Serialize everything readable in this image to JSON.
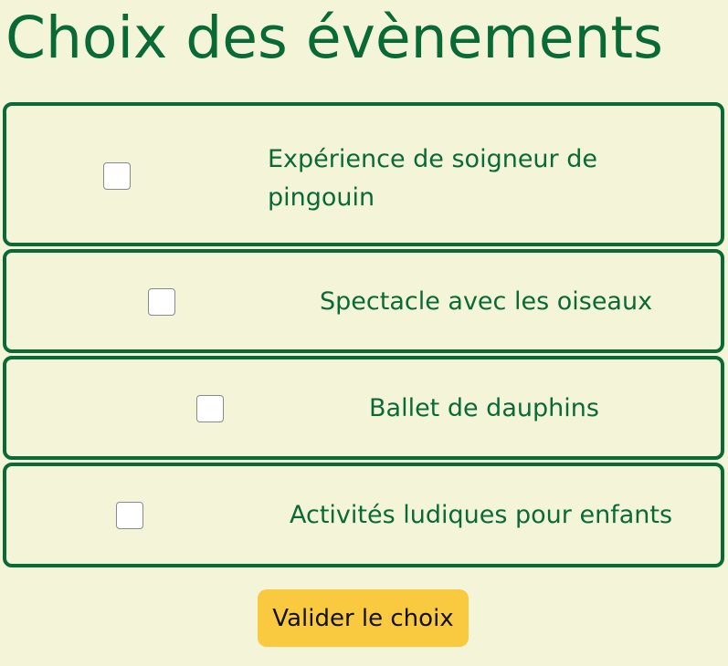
{
  "page": {
    "title": "Choix des évènements"
  },
  "events": [
    {
      "label": "Expérience de soigneur de pingouin",
      "checked": false
    },
    {
      "label": "Spectacle avec les oiseaux",
      "checked": false
    },
    {
      "label": "Ballet de dauphins",
      "checked": false
    },
    {
      "label": "Activités ludiques pour enfants",
      "checked": false
    }
  ],
  "actions": {
    "validate_label": "Valider le choix"
  },
  "colors": {
    "background": "#f4f4d8",
    "accent_green": "#0a6a36",
    "button_yellow": "#f9ca3f"
  }
}
